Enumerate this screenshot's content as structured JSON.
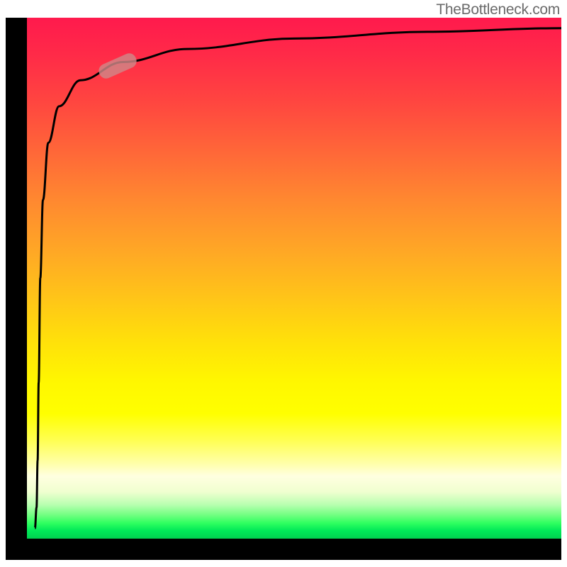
{
  "watermark_text": "TheBottleneck.com",
  "chart_data": {
    "type": "line",
    "title": "",
    "xlabel": "",
    "ylabel": "",
    "x_range": [
      0,
      100
    ],
    "y_range": [
      0,
      100
    ],
    "curve_points": [
      {
        "x": 1.5,
        "y": 2
      },
      {
        "x": 1.8,
        "y": 6
      },
      {
        "x": 2.0,
        "y": 15
      },
      {
        "x": 2.2,
        "y": 30
      },
      {
        "x": 2.5,
        "y": 50
      },
      {
        "x": 3.0,
        "y": 65
      },
      {
        "x": 4.0,
        "y": 76
      },
      {
        "x": 6.0,
        "y": 83
      },
      {
        "x": 10.0,
        "y": 88
      },
      {
        "x": 18.0,
        "y": 91.5
      },
      {
        "x": 30.0,
        "y": 94
      },
      {
        "x": 50.0,
        "y": 96
      },
      {
        "x": 75.0,
        "y": 97.3
      },
      {
        "x": 100.0,
        "y": 98
      }
    ],
    "marker_position": {
      "x": 17,
      "y": 90.8
    },
    "background_gradient": {
      "type": "vertical",
      "stops": [
        {
          "position": 0,
          "color": "#ff1a4d"
        },
        {
          "position": 50,
          "color": "#ffc518"
        },
        {
          "position": 76,
          "color": "#ffff00"
        },
        {
          "position": 100,
          "color": "#00d050"
        }
      ]
    },
    "axes_color": "#000000",
    "curve_color": "#000000",
    "marker_color": "#d08888"
  }
}
